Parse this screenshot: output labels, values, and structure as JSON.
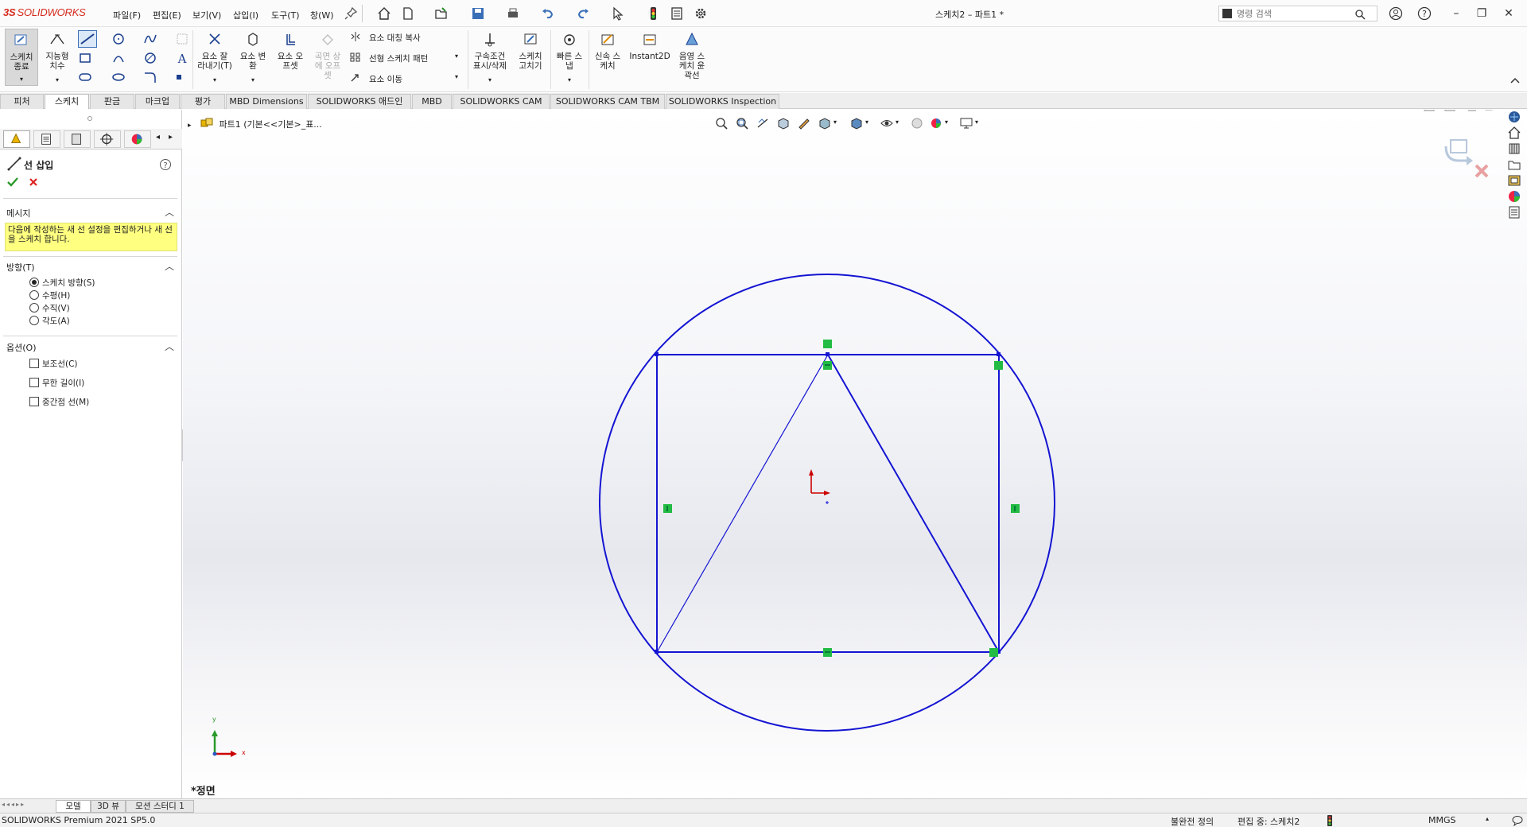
{
  "app": {
    "logo_ds": "3S",
    "logo_text": "SOLIDWORKS"
  },
  "menu": [
    "파일(F)",
    "편집(E)",
    "보기(V)",
    "삽입(I)",
    "도구(T)",
    "창(W)"
  ],
  "window_title": "스케치2 – 파트1 *",
  "command_search": {
    "placeholder": "명령 검색"
  },
  "ribbon": {
    "exit_sketch": [
      "스케치",
      "종료"
    ],
    "smart_dimension": [
      "지능형",
      "치수"
    ],
    "trim_entities": [
      "요소 잘",
      "라내기(T)"
    ],
    "convert_entities": [
      "요소 변",
      "환"
    ],
    "offset_entities": [
      "요소 오",
      "프셋"
    ],
    "offset_on_surface": [
      "곡면 상",
      "에 오프",
      "셋"
    ],
    "mirror_entities": "요소 대칭 복사",
    "linear_pattern": "선형 스케치 패턴",
    "move_entities": "요소 이동",
    "display_relations": [
      "구속조건",
      "표시/삭제"
    ],
    "repair_sketch": [
      "스케치",
      "고치기"
    ],
    "quick_snaps": [
      "빠른 스",
      "냅"
    ],
    "rapid_sketch": [
      "신속 스",
      "케치"
    ],
    "instant2d": "Instant2D",
    "shaded_contours": [
      "음영 스",
      "케치 윤",
      "곽선"
    ]
  },
  "command_tabs": [
    {
      "label": "피처",
      "active": false
    },
    {
      "label": "스케치",
      "active": true
    },
    {
      "label": "판금",
      "active": false
    },
    {
      "label": "마크업",
      "active": false
    },
    {
      "label": "평가",
      "active": false
    },
    {
      "label": "MBD Dimensions",
      "active": false
    },
    {
      "label": "SOLIDWORKS 애드인",
      "active": false
    },
    {
      "label": "MBD",
      "active": false
    },
    {
      "label": "SOLIDWORKS CAM",
      "active": false
    },
    {
      "label": "SOLIDWORKS CAM TBM",
      "active": false
    },
    {
      "label": "SOLIDWORKS Inspection",
      "active": false
    }
  ],
  "property_manager": {
    "title": "선 삽입",
    "message_header": "메시지",
    "message": "다음에 작성하는 새 선 설정을 편집하거나 새 선을 스케치 합니다.",
    "orientation_header": "방향(T)",
    "orientation_options": [
      {
        "label": "스케치 방향(S)",
        "selected": true
      },
      {
        "label": "수평(H)",
        "selected": false
      },
      {
        "label": "수직(V)",
        "selected": false
      },
      {
        "label": "각도(A)",
        "selected": false
      }
    ],
    "options_header": "옵션(O)",
    "checkbox_options": [
      {
        "label": "보조선(C)",
        "checked": false
      },
      {
        "label": "무한 길이(I)",
        "checked": false
      },
      {
        "label": "중간점 선(M)",
        "checked": false
      }
    ]
  },
  "tree": {
    "root": "파트1  (기본<<기본>_표..."
  },
  "view": {
    "orientation_label": "*정면",
    "triad_x": "x",
    "triad_y": "y"
  },
  "bottom_tabs": [
    {
      "label": "모델",
      "active": true
    },
    {
      "label": "3D 뷰",
      "active": false
    },
    {
      "label": "모션 스터디 1",
      "active": false
    }
  ],
  "status": {
    "product": "SOLIDWORKS Premium 2021 SP5.0",
    "definition": "불완전 정의",
    "editing": "편집 중: 스케치2",
    "units": "MMGS"
  },
  "colors": {
    "sketch": "#1414d2",
    "relation": "#22bb44",
    "origin": "#cc0000",
    "brand": "#d52b1e",
    "message_bg": "#ffff80"
  }
}
